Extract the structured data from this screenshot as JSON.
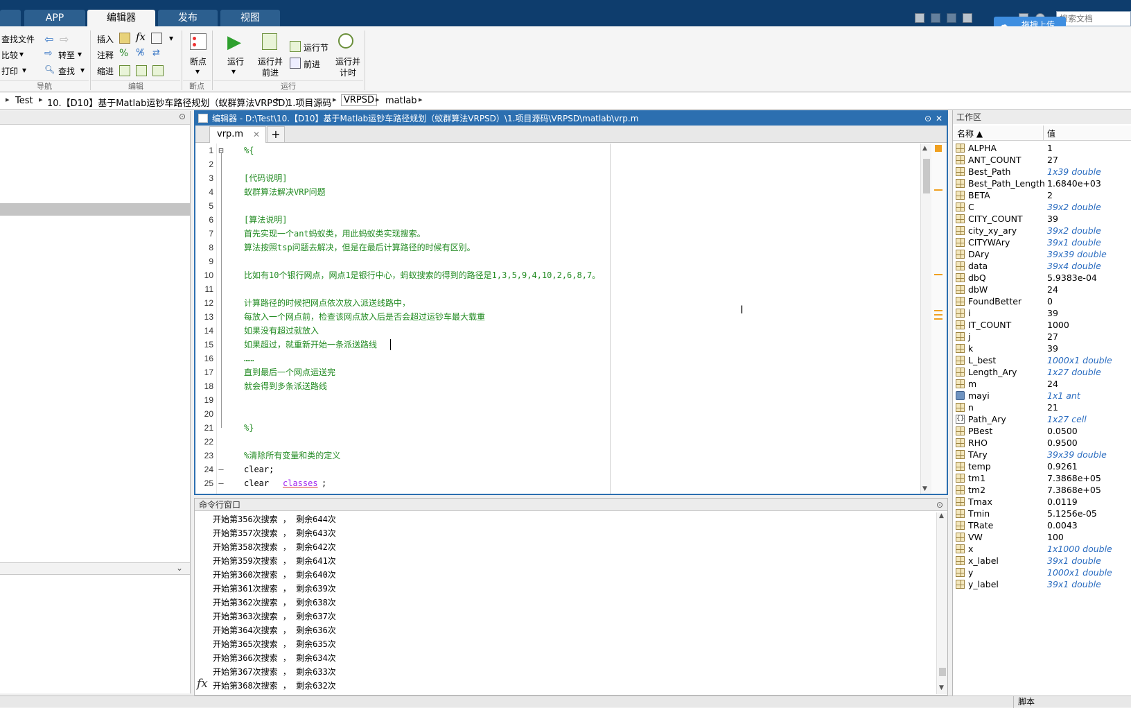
{
  "tabs": {
    "partial": "",
    "app": "APP",
    "editor": "编辑器",
    "publish": "发布",
    "view": "视图"
  },
  "search": {
    "placeholder": "搜索文档"
  },
  "upload_button": "拖拽上传",
  "ribbon": {
    "nav": {
      "find_files": "查找文件",
      "compare": "比较",
      "print": "打印",
      "goto": "转至",
      "find": "查找",
      "group": "导航"
    },
    "edit": {
      "insert": "插入",
      "comment": "注释",
      "indent": "缩进",
      "fx": "fx",
      "group": "编辑"
    },
    "breakpoints": {
      "label": "断点",
      "group": "断点"
    },
    "run": {
      "run": "运行",
      "run_advance_1": "运行并",
      "run_advance_2": "前进",
      "run_section": "运行节",
      "advance": "前进",
      "run_time_1": "运行并",
      "run_time_2": "计时",
      "group": "运行"
    }
  },
  "breadcrumb": [
    "Test",
    "10.【D10】基于Matlab运钞车路径规划（蚁群算法VRPSD）",
    "1.项目源码",
    "VRPSD",
    "matlab"
  ],
  "editor": {
    "title": "编辑器 - D:\\Test\\10.【D10】基于Matlab运钞车路径规划（蚁群算法VRPSD）\\1.项目源码\\VRPSD\\matlab\\vrp.m",
    "tab": "vrp.m",
    "lines": [
      {
        "n": "1",
        "m": "⊟",
        "t": "%{"
      },
      {
        "n": "2",
        "m": "",
        "t": ""
      },
      {
        "n": "3",
        "m": "",
        "t": "[代码说明]"
      },
      {
        "n": "4",
        "m": "",
        "t": "蚁群算法解决VRP问题"
      },
      {
        "n": "5",
        "m": "",
        "t": ""
      },
      {
        "n": "6",
        "m": "",
        "t": "[算法说明]"
      },
      {
        "n": "7",
        "m": "",
        "t": "首先实现一个ant蚂蚁类，用此蚂蚁类实现搜索。"
      },
      {
        "n": "8",
        "m": "",
        "t": "算法按照tsp问题去解决，但是在最后计算路径的时候有区别。"
      },
      {
        "n": "9",
        "m": "",
        "t": ""
      },
      {
        "n": "10",
        "m": "",
        "t": "比如有10个银行网点，网点1是银行中心，蚂蚁搜索的得到的路径是1,3,5,9,4,10,2,6,8,7。"
      },
      {
        "n": "11",
        "m": "",
        "t": ""
      },
      {
        "n": "12",
        "m": "",
        "t": "计算路径的时候把网点依次放入派送线路中，"
      },
      {
        "n": "13",
        "m": "",
        "t": "每放入一个网点前，检查该网点放入后是否会超过运钞车最大载重"
      },
      {
        "n": "14",
        "m": "",
        "t": "如果没有超过就放入"
      },
      {
        "n": "15",
        "m": "",
        "t": "如果超过，就重新开始一条派送路线"
      },
      {
        "n": "16",
        "m": "",
        "t": "……"
      },
      {
        "n": "17",
        "m": "",
        "t": "直到最后一个网点运送完"
      },
      {
        "n": "18",
        "m": "",
        "t": "就会得到多条派送路线"
      },
      {
        "n": "19",
        "m": "",
        "t": ""
      },
      {
        "n": "20",
        "m": "",
        "t": ""
      },
      {
        "n": "21",
        "m": "",
        "t": "%}"
      },
      {
        "n": "22",
        "m": "",
        "t": ""
      },
      {
        "n": "23",
        "m": "",
        "t": "%清除所有变量和类的定义"
      },
      {
        "n": "24",
        "m": "–",
        "t": "clear;"
      },
      {
        "n": "25",
        "m": "–",
        "t": "clear "
      }
    ],
    "line25_keyword": "classes",
    "line25_end": ";"
  },
  "command_window": {
    "title": "命令行窗口",
    "lines": [
      "开始第356次搜索 ， 剩余644次",
      "开始第357次搜索 ， 剩余643次",
      "开始第358次搜索 ， 剩余642次",
      "开始第359次搜索 ， 剩余641次",
      "开始第360次搜索 ， 剩余640次",
      "开始第361次搜索 ， 剩余639次",
      "开始第362次搜索 ， 剩余638次",
      "开始第363次搜索 ， 剩余637次",
      "开始第364次搜索 ， 剩余636次",
      "开始第365次搜索 ， 剩余635次",
      "开始第366次搜索 ， 剩余634次",
      "开始第367次搜索 ， 剩余633次",
      "开始第368次搜索 ， 剩余632次"
    ],
    "fx": "fx"
  },
  "workspace": {
    "title": "工作区",
    "col_name": "名称 ▲",
    "col_value": "值",
    "vars": [
      {
        "name": "ALPHA",
        "value": "1",
        "kind": "num"
      },
      {
        "name": "ANT_COUNT",
        "value": "27",
        "kind": "num"
      },
      {
        "name": "Best_Path",
        "value": "1x39 double",
        "kind": "arr"
      },
      {
        "name": "Best_Path_Length",
        "value": "1.6840e+03",
        "kind": "num"
      },
      {
        "name": "BETA",
        "value": "2",
        "kind": "num"
      },
      {
        "name": "C",
        "value": "39x2 double",
        "kind": "arr"
      },
      {
        "name": "CITY_COUNT",
        "value": "39",
        "kind": "num"
      },
      {
        "name": "city_xy_ary",
        "value": "39x2 double",
        "kind": "arr"
      },
      {
        "name": "CITYWAry",
        "value": "39x1 double",
        "kind": "arr"
      },
      {
        "name": "DAry",
        "value": "39x39 double",
        "kind": "arr"
      },
      {
        "name": "data",
        "value": "39x4 double",
        "kind": "arr"
      },
      {
        "name": "dbQ",
        "value": "5.9383e-04",
        "kind": "num"
      },
      {
        "name": "dbW",
        "value": "24",
        "kind": "num"
      },
      {
        "name": "FoundBetter",
        "value": "0",
        "kind": "num"
      },
      {
        "name": "i",
        "value": "39",
        "kind": "num"
      },
      {
        "name": "IT_COUNT",
        "value": "1000",
        "kind": "num"
      },
      {
        "name": "j",
        "value": "27",
        "kind": "num"
      },
      {
        "name": "k",
        "value": "39",
        "kind": "num"
      },
      {
        "name": "L_best",
        "value": "1000x1 double",
        "kind": "arr"
      },
      {
        "name": "Length_Ary",
        "value": "1x27 double",
        "kind": "arr"
      },
      {
        "name": "m",
        "value": "24",
        "kind": "num"
      },
      {
        "name": "mayi",
        "value": "1x1 ant",
        "kind": "obj"
      },
      {
        "name": "n",
        "value": "21",
        "kind": "num"
      },
      {
        "name": "Path_Ary",
        "value": "1x27 cell",
        "kind": "cell"
      },
      {
        "name": "PBest",
        "value": "0.0500",
        "kind": "num"
      },
      {
        "name": "RHO",
        "value": "0.9500",
        "kind": "num"
      },
      {
        "name": "TAry",
        "value": "39x39 double",
        "kind": "arr"
      },
      {
        "name": "temp",
        "value": "0.9261",
        "kind": "num"
      },
      {
        "name": "tm1",
        "value": "7.3868e+05",
        "kind": "num"
      },
      {
        "name": "tm2",
        "value": "7.3868e+05",
        "kind": "num"
      },
      {
        "name": "Tmax",
        "value": "0.0119",
        "kind": "num"
      },
      {
        "name": "Tmin",
        "value": "5.1256e-05",
        "kind": "num"
      },
      {
        "name": "TRate",
        "value": "0.0043",
        "kind": "num"
      },
      {
        "name": "VW",
        "value": "100",
        "kind": "num"
      },
      {
        "name": "x",
        "value": "1x1000 double",
        "kind": "arr"
      },
      {
        "name": "x_label",
        "value": "39x1 double",
        "kind": "arr"
      },
      {
        "name": "y",
        "value": "1000x1 double",
        "kind": "arr"
      },
      {
        "name": "y_label",
        "value": "39x1 double",
        "kind": "arr"
      }
    ]
  },
  "status": {
    "script": "脚本"
  }
}
